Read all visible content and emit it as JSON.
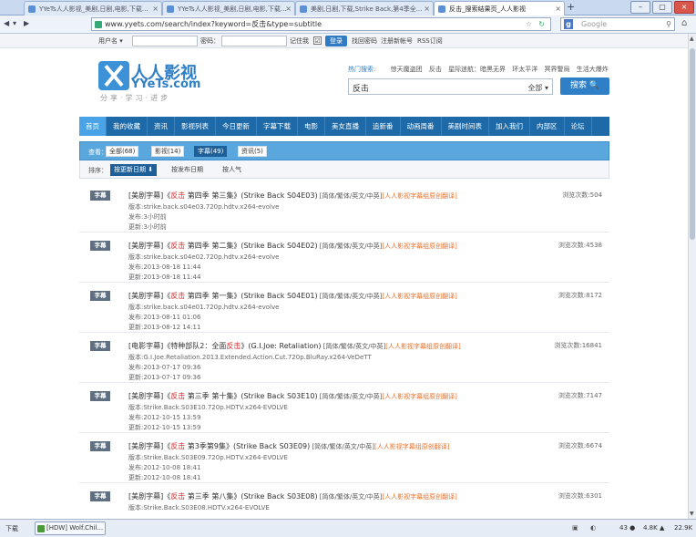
{
  "browser": {
    "tabs": [
      {
        "label": "YYeTs人人影视_美剧,日剧,电影,下载...",
        "active": false
      },
      {
        "label": "YYeTs人人影视_美剧,日剧,电影,下载...",
        "active": false
      },
      {
        "label": "美剧,日剧,下载,Strike Back,第4季全...",
        "active": false
      },
      {
        "label": "反击_搜索结果页_人人影视",
        "active": true
      }
    ],
    "new_tab": "+",
    "window_controls": [
      "–",
      "▢",
      "×"
    ],
    "url": "www.yyets.com/search/index?keyword=反击&type=subtitle",
    "search_engine_letter": "g",
    "search_placeholder": "Google",
    "colors": {
      "accent": "#2f7fc6",
      "nav": "#1e6aa8",
      "keyword": "#d62e2e",
      "group": "#e8712a"
    }
  },
  "login": {
    "username_label": "用户名 ▾",
    "password_label": "密码：",
    "remember_label": "记住我",
    "remember_checked": "☑",
    "login_button": "登录",
    "forgot": "找回密码",
    "register": "注册新帐号",
    "rss": "RSS订阅"
  },
  "header": {
    "logo_cn": "人人影视",
    "logo_en": "YYeTs.com",
    "slogan": "分享·学习·进步",
    "hot_label": "热门搜索:",
    "hot_items": [
      "惊天魔盗团",
      "反击",
      "星际迷航：暗黑无界",
      "环太平洋",
      "冥界警局",
      "生活大爆炸"
    ],
    "search_value": "反击",
    "search_category": "全部 ▾",
    "search_button": "搜索 🔍"
  },
  "nav": [
    "首页",
    "我的收藏",
    "资讯",
    "影视列表",
    "今日更新",
    "字幕下载",
    "电影",
    "美女直播",
    "追新番",
    "动画周番",
    "美剧时间表",
    "加入我们",
    "内部区",
    "论坛"
  ],
  "filter": {
    "label": "查看：",
    "options": [
      {
        "label": "全部(68)",
        "active": false
      },
      {
        "label": "影视(14)",
        "active": false
      },
      {
        "label": "字幕(49)",
        "active": true
      },
      {
        "label": "资讯(5)",
        "active": false
      }
    ]
  },
  "sort": {
    "label": "排序：",
    "options": [
      {
        "label": "按更新日期 ⬇",
        "active": true
      },
      {
        "label": "按发布日期",
        "active": false
      },
      {
        "label": "按人气",
        "active": false
      }
    ]
  },
  "results": [
    {
      "badge": "字幕",
      "pre": "[美剧字幕]《",
      "kw": "反击",
      "post": " 第四季 第三集》(Strike Back S04E03)",
      "fmt": " [简体/繁体/英文/中英]",
      "grp": "[人人影视字幕组原创翻译]",
      "version": "版本:strike.back.s04e03.720p.hdtv.x264-evolve",
      "published": "发布:3小时前",
      "updated": "更新:3小时前",
      "views": "浏览次数:504"
    },
    {
      "badge": "字幕",
      "pre": "[美剧字幕]《",
      "kw": "反击",
      "post": " 第四季 第二集》(Strike Back S04E02)",
      "fmt": " [简体/繁体/英文/中英]",
      "grp": "[人人影视字幕组原创翻译]",
      "version": "版本:strike.back.s04e02.720p.hdtv.x264-evolve",
      "published": "发布:2013-08-18 11:44",
      "updated": "更新:2013-08-18 11:44",
      "views": "浏览次数:4538"
    },
    {
      "badge": "字幕",
      "pre": "[美剧字幕]《",
      "kw": "反击",
      "post": " 第四季 第一集》(Strike Back S04E01)",
      "fmt": " [简体/繁体/英文/中英]",
      "grp": "[人人影视字幕组原创翻译]",
      "version": "版本:strike.back.s04e01.720p.hdtv.x264-evolve",
      "published": "发布:2013-08-11 01:06",
      "updated": "更新:2013-08-12 14:11",
      "views": "浏览次数:8172"
    },
    {
      "badge": "字幕",
      "pre": "[电影字幕]《特种部队2：全面",
      "kw": "反击",
      "post": "》(G.I.Joe: Retaliation)",
      "fmt": " [简体/繁体/英文/中英]",
      "grp": "[人人影视字幕组原创翻译]",
      "version": "版本:G.I.Joe.Retaliation.2013.Extended.Action.Cut.720p.BluRay.x264-VeDeTT",
      "published": "发布:2013-07-17 09:36",
      "updated": "更新:2013-07-17 09:36",
      "views": "浏览次数:16841"
    },
    {
      "badge": "字幕",
      "pre": "[美剧字幕]《",
      "kw": "反击",
      "post": " 第三季 第十集》(Strike Back S03E10)",
      "fmt": " [简体/繁体/英文/中英]",
      "grp": "[人人影视字幕组原创翻译]",
      "version": "版本:Strike.Back.S03E10.720p.HDTV.x264-EVOLVE",
      "published": "发布:2012-10-15 13:59",
      "updated": "更新:2012-10-15 13:59",
      "views": "浏览次数:7147"
    },
    {
      "badge": "字幕",
      "pre": "[美剧字幕]《",
      "kw": "反击",
      "post": " 第3季第9集》(Strike Back S03E09)",
      "fmt": " [简体/繁体/英文/中英]",
      "grp": "[人人影视字幕组原创翻译]",
      "version": "版本:Strike.Back.S03E09.720p.HDTV.x264-EVOLVE",
      "published": "发布:2012-10-08 18:41",
      "updated": "更新:2012-10-08 18:41",
      "views": "浏览次数:6674"
    },
    {
      "badge": "字幕",
      "pre": "[美剧字幕]《",
      "kw": "反击",
      "post": " 第三季 第八集》(Strike Back S03E08)",
      "fmt": " [简体/繁体/英文/中英]",
      "grp": "[人人影视字幕组原创翻译]",
      "version": "版本:Strike.Back.S03E08.HDTV.x264-EVOLVE",
      "published": "",
      "updated": "",
      "views": "浏览次数:6301"
    }
  ],
  "statusbar": {
    "download": "下载",
    "task": "[HDW] Wolf.Chil...",
    "tray": [
      "▣",
      "◐",
      "43 ●",
      "4.8K ▲",
      "22.9K"
    ]
  }
}
